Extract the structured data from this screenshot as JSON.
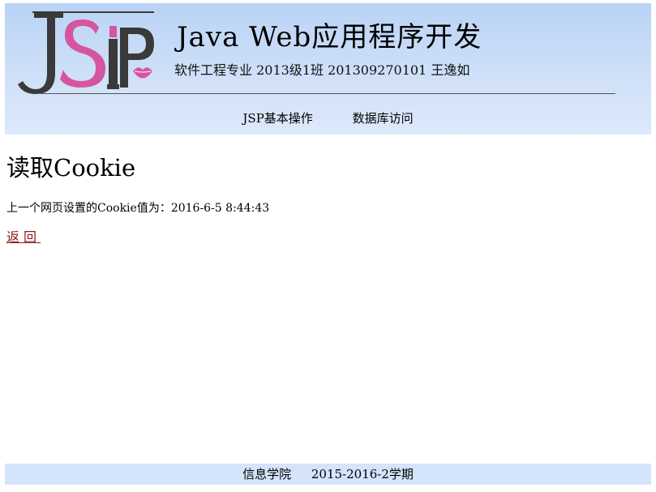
{
  "header": {
    "logo_text": "JSP",
    "title": "Java Web应用程序开发",
    "subtitle": "软件工程专业 2013级1班 201309270101 王逸如",
    "nav": [
      {
        "label": "JSP基本操作"
      },
      {
        "label": "数据库访问"
      }
    ]
  },
  "main": {
    "heading": "读取Cookie",
    "cookie_text": "上一个网页设置的Cookie值为：2016-6-5 8:44:43",
    "back_link": "返回"
  },
  "footer": {
    "college": "信息学院",
    "term": "2015-2016-2学期"
  },
  "colors": {
    "header_bg": "#c8dcf7",
    "footer_bg": "#d4e4fa",
    "logo_dark": "#3a3a3a",
    "logo_pink": "#d6559f",
    "link": "#8b1a1a"
  }
}
